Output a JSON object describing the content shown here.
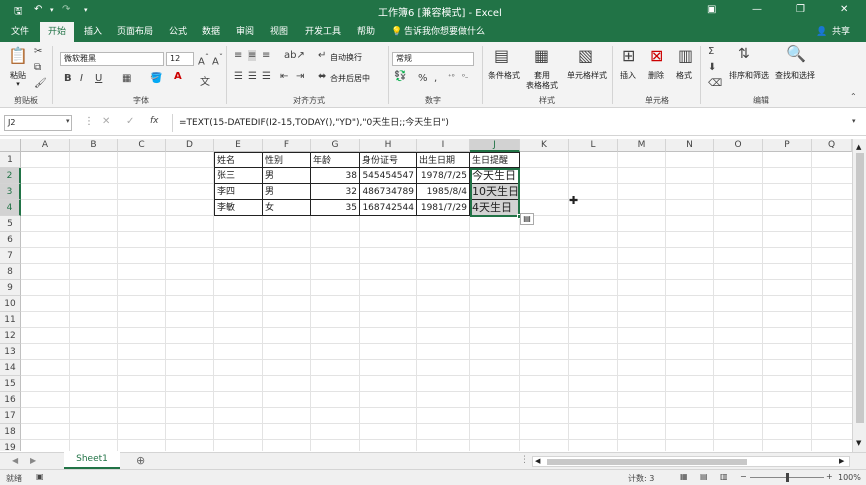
{
  "window": {
    "title": "工作簿6 [兼容模式] - Excel",
    "user": "共享"
  },
  "tabs": [
    "文件",
    "开始",
    "插入",
    "页面布局",
    "公式",
    "数据",
    "审阅",
    "视图",
    "开发工具",
    "帮助"
  ],
  "tell_me": "告诉我你想要做什么",
  "ribbon": {
    "paste": "粘贴",
    "clipboard": "剪贴板",
    "font_name": "微软雅黑",
    "font_size": "12",
    "font_group": "字体",
    "wrap_text": "自动换行",
    "merge_center": "合并后居中",
    "alignment_group": "对齐方式",
    "number_format": "常规",
    "number_group": "数字",
    "cond_format": "条件格式",
    "table_format_1": "套用",
    "table_format_2": "表格格式",
    "cell_style": "单元格样式",
    "styles_group": "样式",
    "insert": "插入",
    "delete": "删除",
    "format": "格式",
    "cells_group": "单元格",
    "sort_filter": "排序和筛选",
    "find_select": "查找和选择",
    "editing_group": "编辑",
    "bold": "B",
    "italic": "I",
    "underline": "U",
    "percent": "%",
    "comma": ","
  },
  "formula_bar": {
    "name_box": "J2",
    "fx": "fx",
    "formula": "=TEXT(15-DATEDIF(I2-15,TODAY(),\"YD\"),\"0天生日;;今天生日\")"
  },
  "columns": [
    "A",
    "B",
    "C",
    "D",
    "E",
    "F",
    "G",
    "H",
    "I",
    "J",
    "K",
    "L",
    "M",
    "N",
    "O",
    "P",
    "Q"
  ],
  "rows": [
    "1",
    "2",
    "3",
    "4",
    "5",
    "6",
    "7",
    "8",
    "9",
    "10",
    "11",
    "12",
    "13",
    "14",
    "15",
    "16",
    "17",
    "18",
    "19"
  ],
  "table": {
    "headers": [
      "姓名",
      "性别",
      "年龄",
      "身份证号",
      "出生日期",
      "生日提醒"
    ],
    "data": [
      [
        "张三",
        "男",
        "38",
        "545454547",
        "1978/7/25",
        "今天生日"
      ],
      [
        "李四",
        "男",
        "32",
        "486734789",
        "1985/8/4",
        "10天生日"
      ],
      [
        "李敏",
        "女",
        "35",
        "168742544",
        "1981/7/29",
        "4天生日"
      ]
    ]
  },
  "sheet_tab": "Sheet1",
  "status": {
    "mode": "就绪",
    "count": "计数: 3",
    "zoom": "100%"
  },
  "colors": {
    "excel_green": "#217346",
    "selection": "#217346",
    "selected_fill": "#d3d3d3"
  },
  "icons": [
    "save-icon",
    "undo-icon",
    "redo-icon",
    "minimize-icon",
    "restore-icon",
    "close-icon",
    "lightbulb-icon",
    "person-icon",
    "scissors-icon",
    "copy-icon",
    "format-painter-icon",
    "cursor-plus-icon",
    "add-sheet-icon",
    "quick-analysis-icon"
  ]
}
